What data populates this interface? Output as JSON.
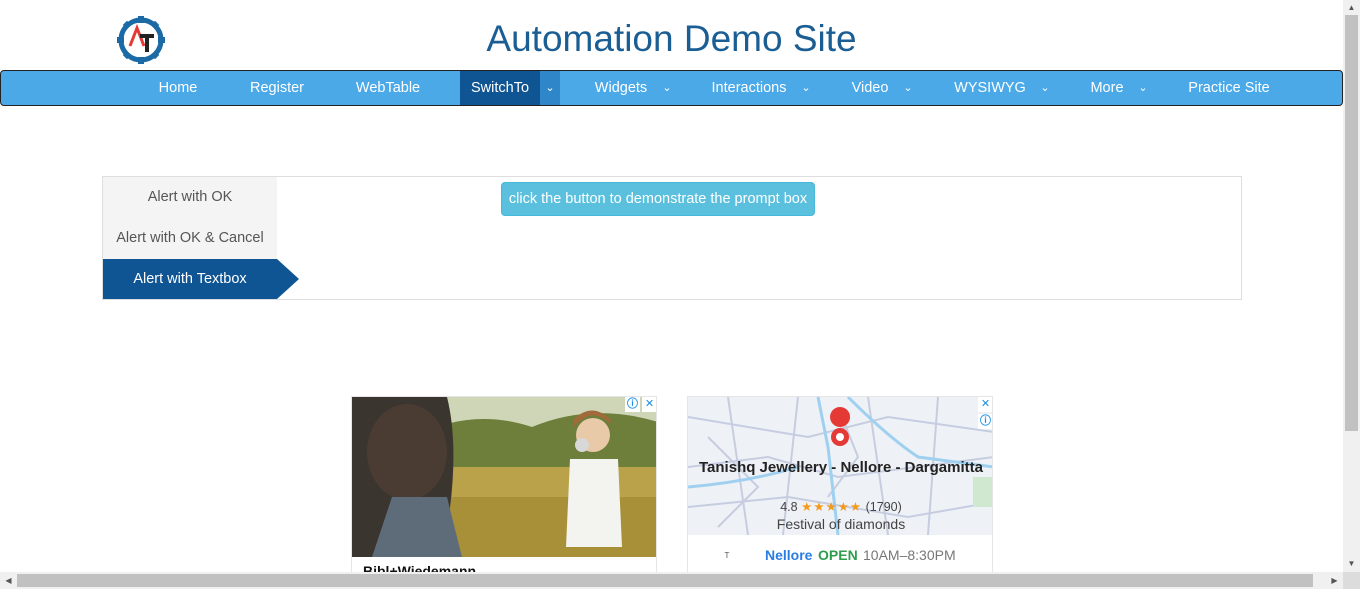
{
  "header": {
    "title": "Automation Demo Site",
    "logo_icon": "gear-logo-icon",
    "logo_letters": "AT"
  },
  "nav": {
    "items": [
      {
        "label": "Home",
        "has_dropdown": false
      },
      {
        "label": "Register",
        "has_dropdown": false
      },
      {
        "label": "WebTable",
        "has_dropdown": false
      },
      {
        "label": "SwitchTo",
        "has_dropdown": true,
        "active": true
      },
      {
        "label": "Widgets",
        "has_dropdown": true
      },
      {
        "label": "Interactions",
        "has_dropdown": true
      },
      {
        "label": "Video",
        "has_dropdown": true
      },
      {
        "label": "WYSIWYG",
        "has_dropdown": true
      },
      {
        "label": "More",
        "has_dropdown": true
      },
      {
        "label": "Practice Site",
        "has_dropdown": false
      }
    ],
    "caret_glyph": "⌄"
  },
  "alerts": {
    "tabs": [
      {
        "label": "Alert with OK"
      },
      {
        "label": "Alert with OK & Cancel"
      },
      {
        "label": "Alert with Textbox",
        "active": true
      }
    ],
    "button_label": "click the button to demonstrate the prompt box"
  },
  "ads": {
    "ad1": {
      "brand": "Bibl+Wiedemann",
      "info_glyph": "ⓘ",
      "close_glyph": "✕"
    },
    "ad2": {
      "name": "Tanishq Jewellery - Nellore - Dargamitta",
      "rating": "4.8",
      "stars": "★★★★★",
      "reviews": "(1790)",
      "tagline": "Festival of diamonds",
      "city": "Nellore",
      "status": "OPEN",
      "hours": "10AM–8:30PM",
      "logo_text": "T",
      "close_glyph": "✕",
      "info_glyph": "ⓘ"
    }
  },
  "colors": {
    "nav_bg": "#4ba9e8",
    "nav_active": "#0f5493",
    "title": "#1b5e94",
    "button": "#5bc0de"
  }
}
